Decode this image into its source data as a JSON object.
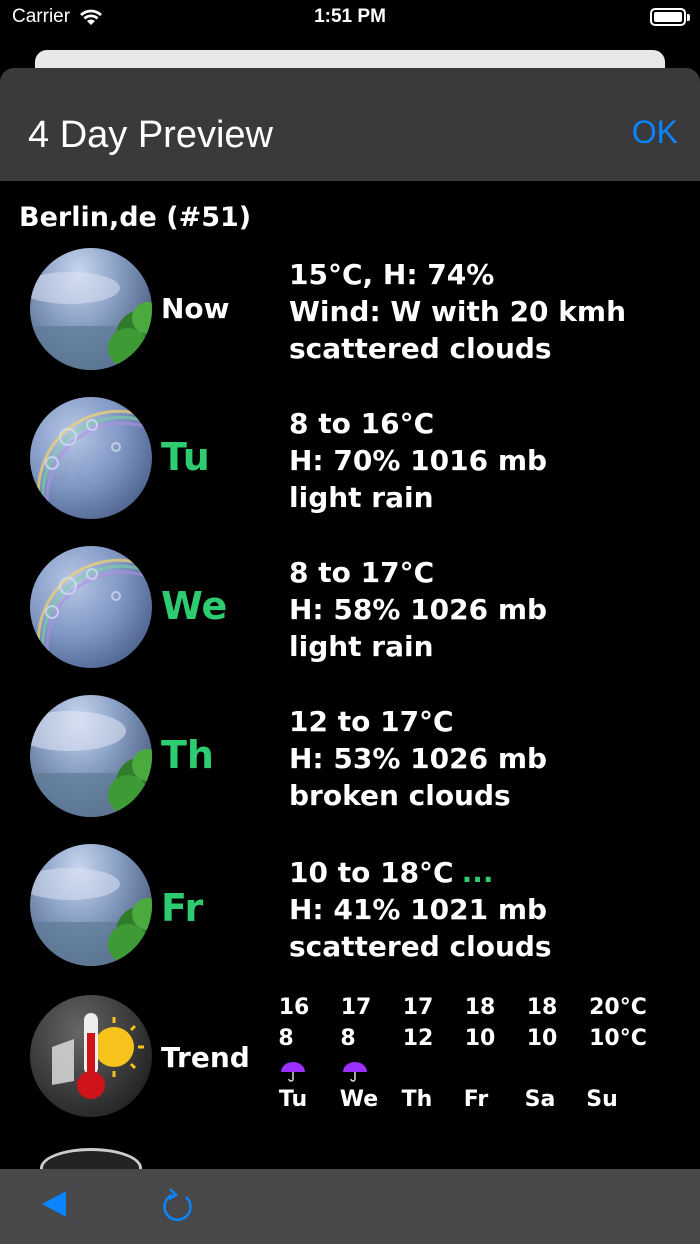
{
  "status": {
    "carrier": "Carrier",
    "time": "1:51 PM"
  },
  "nav": {
    "title": "4 Day Preview",
    "ok_label": "OK"
  },
  "location": "Berlin,de (#51)",
  "forecast": [
    {
      "day": "Now",
      "icon": "scattered-clouds-icon",
      "line1": "15°C, H: 74%",
      "line2": "Wind: W with 20 kmh",
      "line3": "scattered clouds"
    },
    {
      "day": "Tu",
      "icon": "light-rain-icon",
      "line1": "8 to 16°C",
      "line2": "H: 70% 1016 mb",
      "line3": "light rain"
    },
    {
      "day": "We",
      "icon": "light-rain-icon",
      "line1": "8 to 17°C",
      "line2": "H: 58% 1026 mb",
      "line3": "light rain"
    },
    {
      "day": "Th",
      "icon": "broken-clouds-icon",
      "line1": "12 to 17°C",
      "line2": "H: 53% 1026 mb",
      "line3": "broken clouds"
    },
    {
      "day": "Fr",
      "icon": "scattered-clouds-icon",
      "line1": "10 to 18°C",
      "line1_more": "...",
      "line2": "H: 41% 1021 mb",
      "line3": "scattered clouds"
    }
  ],
  "trend": {
    "label": "Trend",
    "highs": [
      "16",
      "17",
      "17",
      "18",
      "18",
      "20°C"
    ],
    "lows": [
      "8",
      "8",
      "12",
      "10",
      "10",
      "10°C"
    ],
    "days": [
      "Tu",
      "We",
      "Th",
      "Fr",
      "Sa",
      "Su"
    ],
    "rain_days": [
      true,
      true,
      false,
      false,
      false,
      false
    ]
  },
  "colors": {
    "accent": "#0a84ff",
    "day_green": "#2ecc71",
    "nav_bg": "#3a3a3c",
    "toolbar_bg": "#48484a",
    "umbrella": "#9b30ff"
  }
}
